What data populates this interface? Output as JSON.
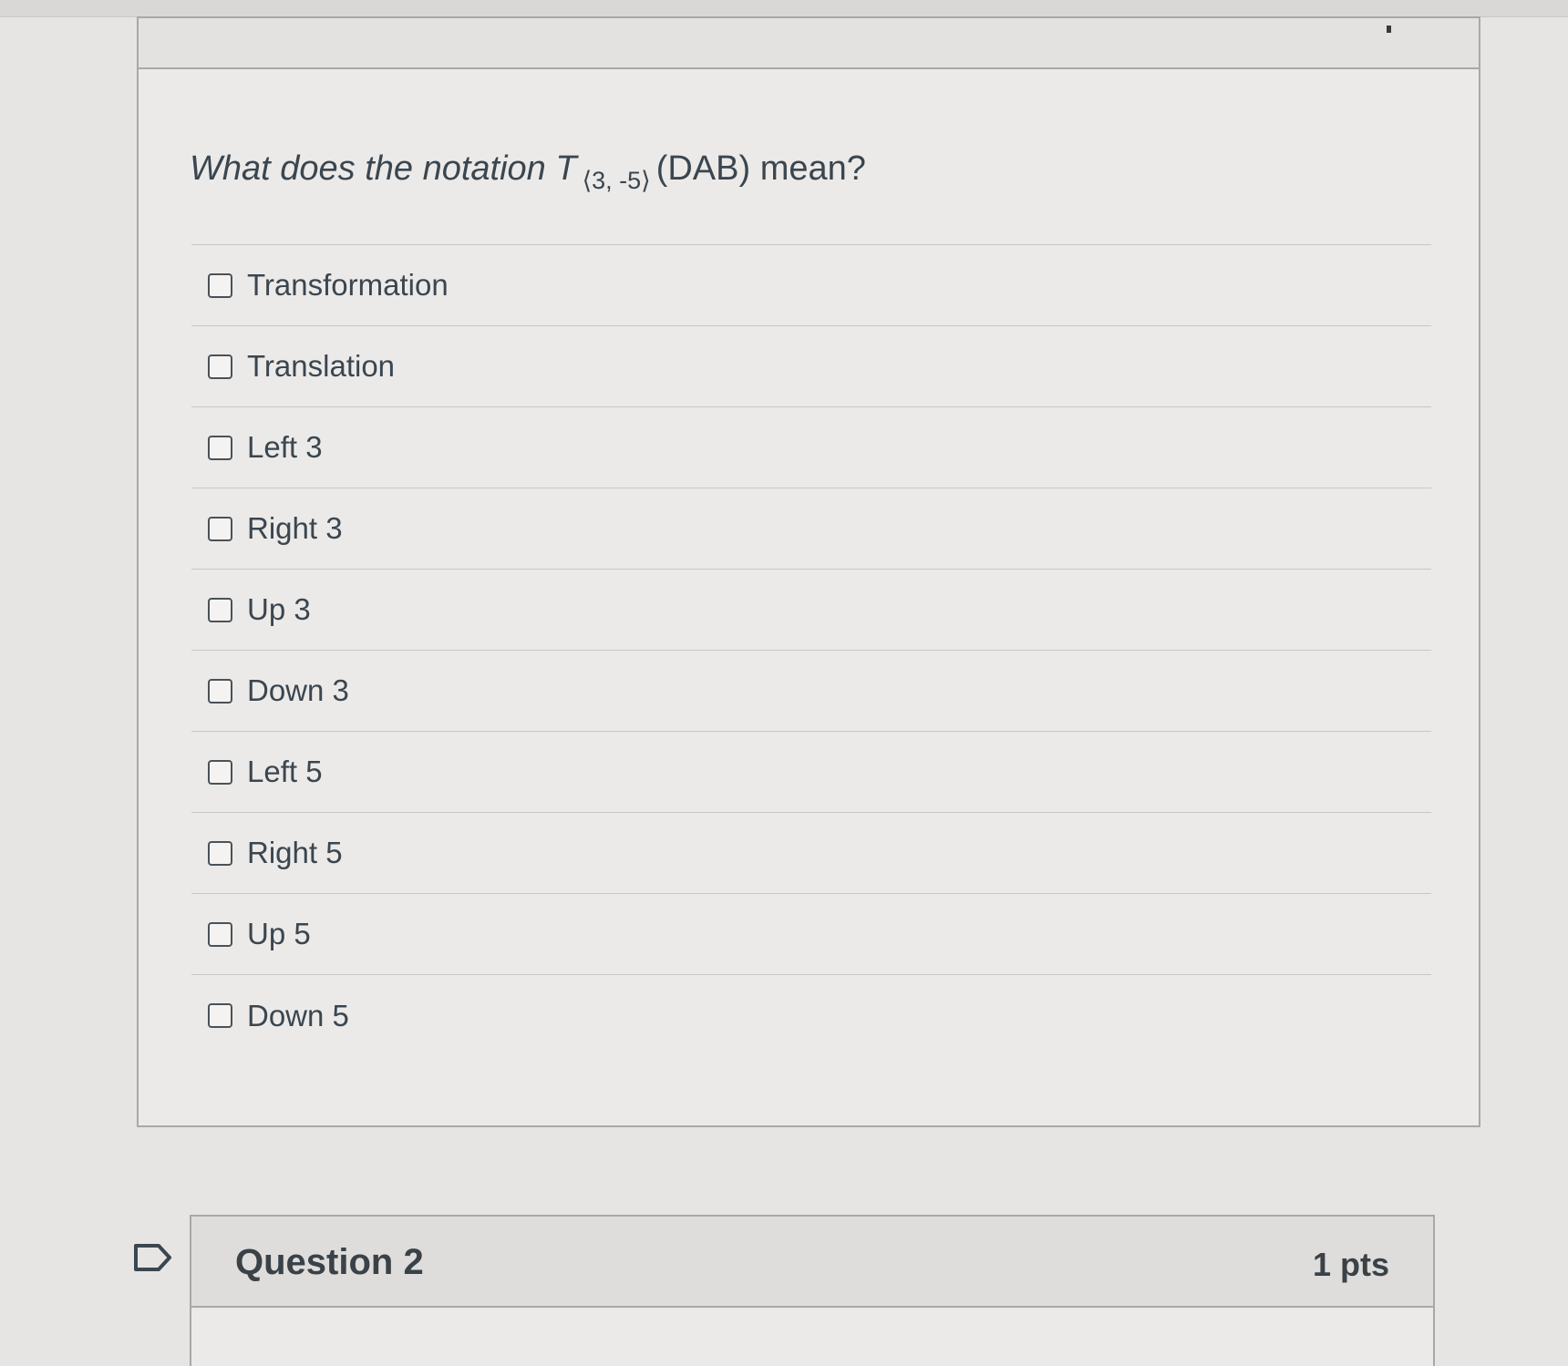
{
  "question1": {
    "prompt_lead": "What does the notation",
    "notation_symbol": "T",
    "notation_subscript": "⟨3, -5⟩",
    "notation_argument": "(DAB)",
    "prompt_tail": "mean?",
    "answers": [
      {
        "label": "Transformation",
        "checked": false
      },
      {
        "label": "Translation",
        "checked": false
      },
      {
        "label": "Left 3",
        "checked": false
      },
      {
        "label": "Right 3",
        "checked": false
      },
      {
        "label": "Up 3",
        "checked": false
      },
      {
        "label": "Down 3",
        "checked": false
      },
      {
        "label": "Left 5",
        "checked": false
      },
      {
        "label": "Right 5",
        "checked": false
      },
      {
        "label": "Up 5",
        "checked": false
      },
      {
        "label": "Down 5",
        "checked": false
      }
    ]
  },
  "question2": {
    "title": "Question 2",
    "points": "1 pts"
  },
  "icons": {
    "flag": "flag-outline-icon",
    "checkbox": "checkbox-unchecked-icon"
  },
  "colors": {
    "page_background": "#e6e5e3",
    "card_background": "#eceae8",
    "text": "#3a4650",
    "border": "#a9a8a6"
  }
}
